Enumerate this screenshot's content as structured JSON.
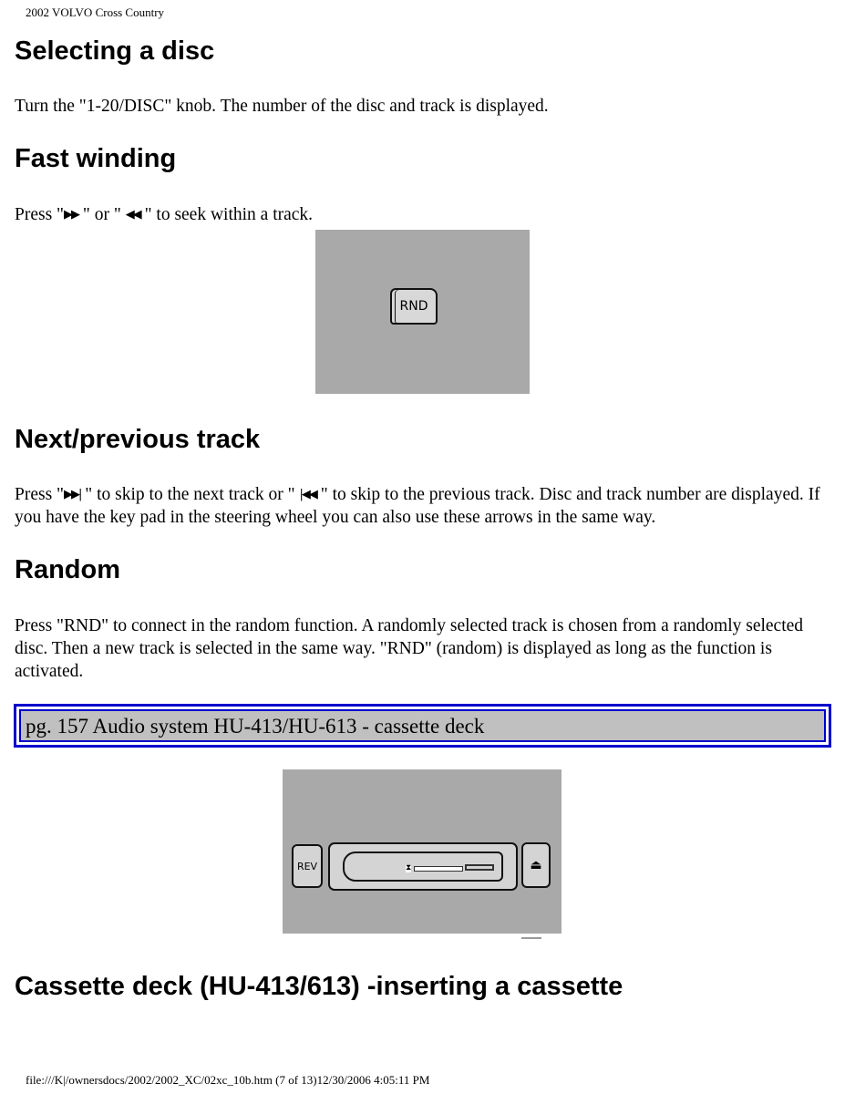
{
  "header": {
    "title": "2002 VOLVO Cross Country"
  },
  "sections": [
    {
      "heading": "Selecting a disc",
      "text": "Turn the \"1-20/DISC\" knob. The number of the disc and track is displayed."
    },
    {
      "heading": "Fast winding",
      "text_parts": [
        "Press \"",
        "▶▶",
        " \" or \" ",
        "◀◀",
        " \" to seek within a track."
      ],
      "icons": [
        "fast-forward-icon",
        "rewind-icon"
      ]
    },
    {
      "heading": "Next/previous track",
      "text_parts": [
        "Press \"",
        "▶▶|",
        " \" to skip to the next track or \" ",
        "|◀◀",
        " \" to skip to the previous track. Disc and track number are displayed. If you have the key pad in the steering wheel you can also use these arrows in the same way."
      ],
      "icons": [
        "skip-next-icon",
        "skip-previous-icon"
      ]
    },
    {
      "heading": "Random",
      "text": "Press \"RND\" to connect in the random function. A randomly selected track is chosen from a randomly selected disc. Then a new track is selected in the same way. \"RND\" (random) is displayed as long as the function is activated."
    },
    {
      "heading": "Cassette deck (HU-413/613) -inserting a cassette"
    }
  ],
  "figures": {
    "rnd": {
      "button_label": "RND"
    },
    "cassette": {
      "rev_label": "REV",
      "eject_symbol": "⏏",
      "tape_marker": "⧗"
    }
  },
  "page_link": {
    "label": "pg. 157 Audio system HU-413/HU-613 - cassette deck"
  },
  "footer": {
    "text": "file:///K|/ownersdocs/2002/2002_XC/02xc_10b.htm (7 of 13)12/30/2006 4:05:11 PM"
  }
}
